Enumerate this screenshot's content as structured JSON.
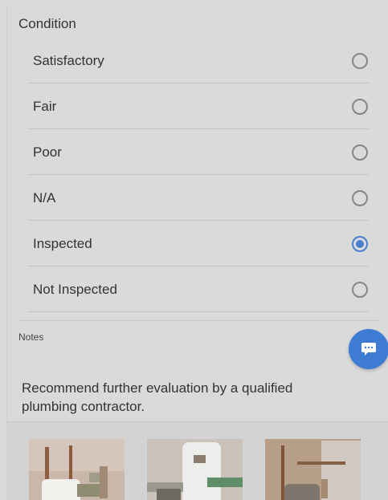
{
  "condition": {
    "title": "Condition",
    "options": [
      {
        "label": "Satisfactory",
        "selected": false
      },
      {
        "label": "Fair",
        "selected": false
      },
      {
        "label": "Poor",
        "selected": false
      },
      {
        "label": "N/A",
        "selected": false
      },
      {
        "label": "Inspected",
        "selected": true
      },
      {
        "label": "Not Inspected",
        "selected": false
      }
    ]
  },
  "notes": {
    "label": "Notes",
    "text": "Recommend further evaluation by a qualified plumbing contractor."
  },
  "fab": {
    "icon": "chat-bubble-icon"
  },
  "photos": [
    {
      "icon": "photo-thumbnail"
    },
    {
      "icon": "photo-thumbnail"
    },
    {
      "icon": "photo-thumbnail"
    }
  ],
  "colors": {
    "accent": "#4a7fd1",
    "fab": "#3e7bd3"
  }
}
